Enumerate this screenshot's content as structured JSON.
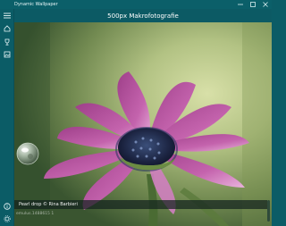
{
  "window": {
    "title": "Dynamic Wallpaper",
    "controls": [
      "minimize-icon",
      "maximize-icon",
      "close-icon"
    ]
  },
  "rail": {
    "items": [
      {
        "icon": "hamburger-menu-icon"
      },
      {
        "icon": "home-icon"
      },
      {
        "icon": "trophy-icon"
      },
      {
        "icon": "gallery-icon"
      },
      {
        "icon": "info-icon"
      },
      {
        "icon": "gear-icon"
      }
    ]
  },
  "header": {
    "title": "500px Makrofotografie"
  },
  "photo": {
    "caption": "Pearl drop © Rina Barbieri",
    "meta": "emulus.1488615 1"
  },
  "colors": {
    "titlebar": "#0b5f69",
    "rail": "#0b5c66",
    "header": "#0c5a64",
    "petal": "#b84fa0",
    "petal_light": "#e4a6d6",
    "center": "#1f2a49",
    "stem": "#4a6b33"
  }
}
